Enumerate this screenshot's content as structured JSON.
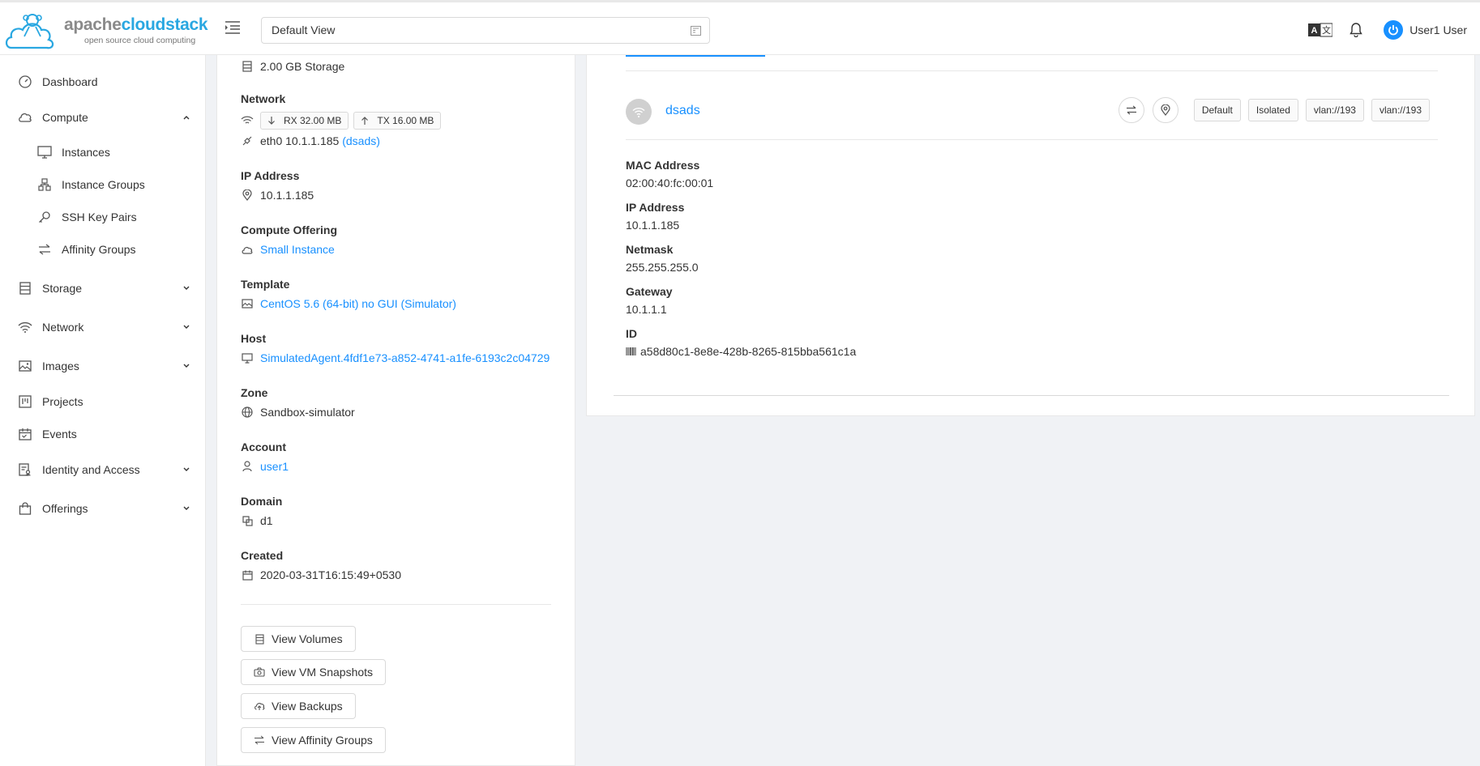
{
  "header": {
    "logo_word_a": "apache",
    "logo_word_b": "cloudstack",
    "logo_tagline": "open source cloud computing",
    "view_selector": "Default View",
    "user_name": "User1 User"
  },
  "sidebar": {
    "items": [
      {
        "label": "Dashboard",
        "icon": "dashboard-icon"
      },
      {
        "label": "Compute",
        "icon": "cloud-icon"
      },
      {
        "label": "Instances",
        "icon": "desktop-icon"
      },
      {
        "label": "Instance Groups",
        "icon": "cluster-icon"
      },
      {
        "label": "SSH Key Pairs",
        "icon": "key-icon"
      },
      {
        "label": "Affinity Groups",
        "icon": "swap-icon"
      },
      {
        "label": "Storage",
        "icon": "database-icon"
      },
      {
        "label": "Network",
        "icon": "wifi-icon"
      },
      {
        "label": "Images",
        "icon": "picture-icon"
      },
      {
        "label": "Projects",
        "icon": "project-icon"
      },
      {
        "label": "Events",
        "icon": "schedule-icon"
      },
      {
        "label": "Identity and Access",
        "icon": "solution-icon"
      },
      {
        "label": "Offerings",
        "icon": "shopping-icon"
      }
    ]
  },
  "details": {
    "storage": "2.00 GB Storage",
    "network_label": "Network",
    "rx": "RX 32.00 MB",
    "tx": "TX 16.00 MB",
    "nic_text": "eth0 10.1.1.185",
    "nic_link": "(dsads)",
    "ip_label": "IP Address",
    "ip": "10.1.1.185",
    "offering_label": "Compute Offering",
    "offering": "Small Instance",
    "template_label": "Template",
    "template": "CentOS 5.6 (64-bit) no GUI (Simulator)",
    "host_label": "Host",
    "host": "SimulatedAgent.4fdf1e73-a852-4741-a1fe-6193c2c04729",
    "zone_label": "Zone",
    "zone": "Sandbox-simulator",
    "account_label": "Account",
    "account": "user1",
    "domain_label": "Domain",
    "domain": "d1",
    "created_label": "Created",
    "created": "2020-03-31T16:15:49+0530",
    "buttons": {
      "volumes": "View Volumes",
      "snapshots": "View VM Snapshots",
      "backups": "View Backups",
      "affinity": "View Affinity Groups"
    }
  },
  "nic": {
    "name": "dsads",
    "tags": [
      "Default",
      "Isolated",
      "vlan://193",
      "vlan://193"
    ],
    "mac_label": "MAC Address",
    "mac": "02:00:40:fc:00:01",
    "ip_label": "IP Address",
    "ip": "10.1.1.185",
    "netmask_label": "Netmask",
    "netmask": "255.255.255.0",
    "gateway_label": "Gateway",
    "gateway": "10.1.1.1",
    "id_label": "ID",
    "id": "a58d80c1-8e8e-428b-8265-815bba561c1a"
  },
  "colors": {
    "accent": "#1890ff",
    "logo_blue": "#29a7e1"
  }
}
